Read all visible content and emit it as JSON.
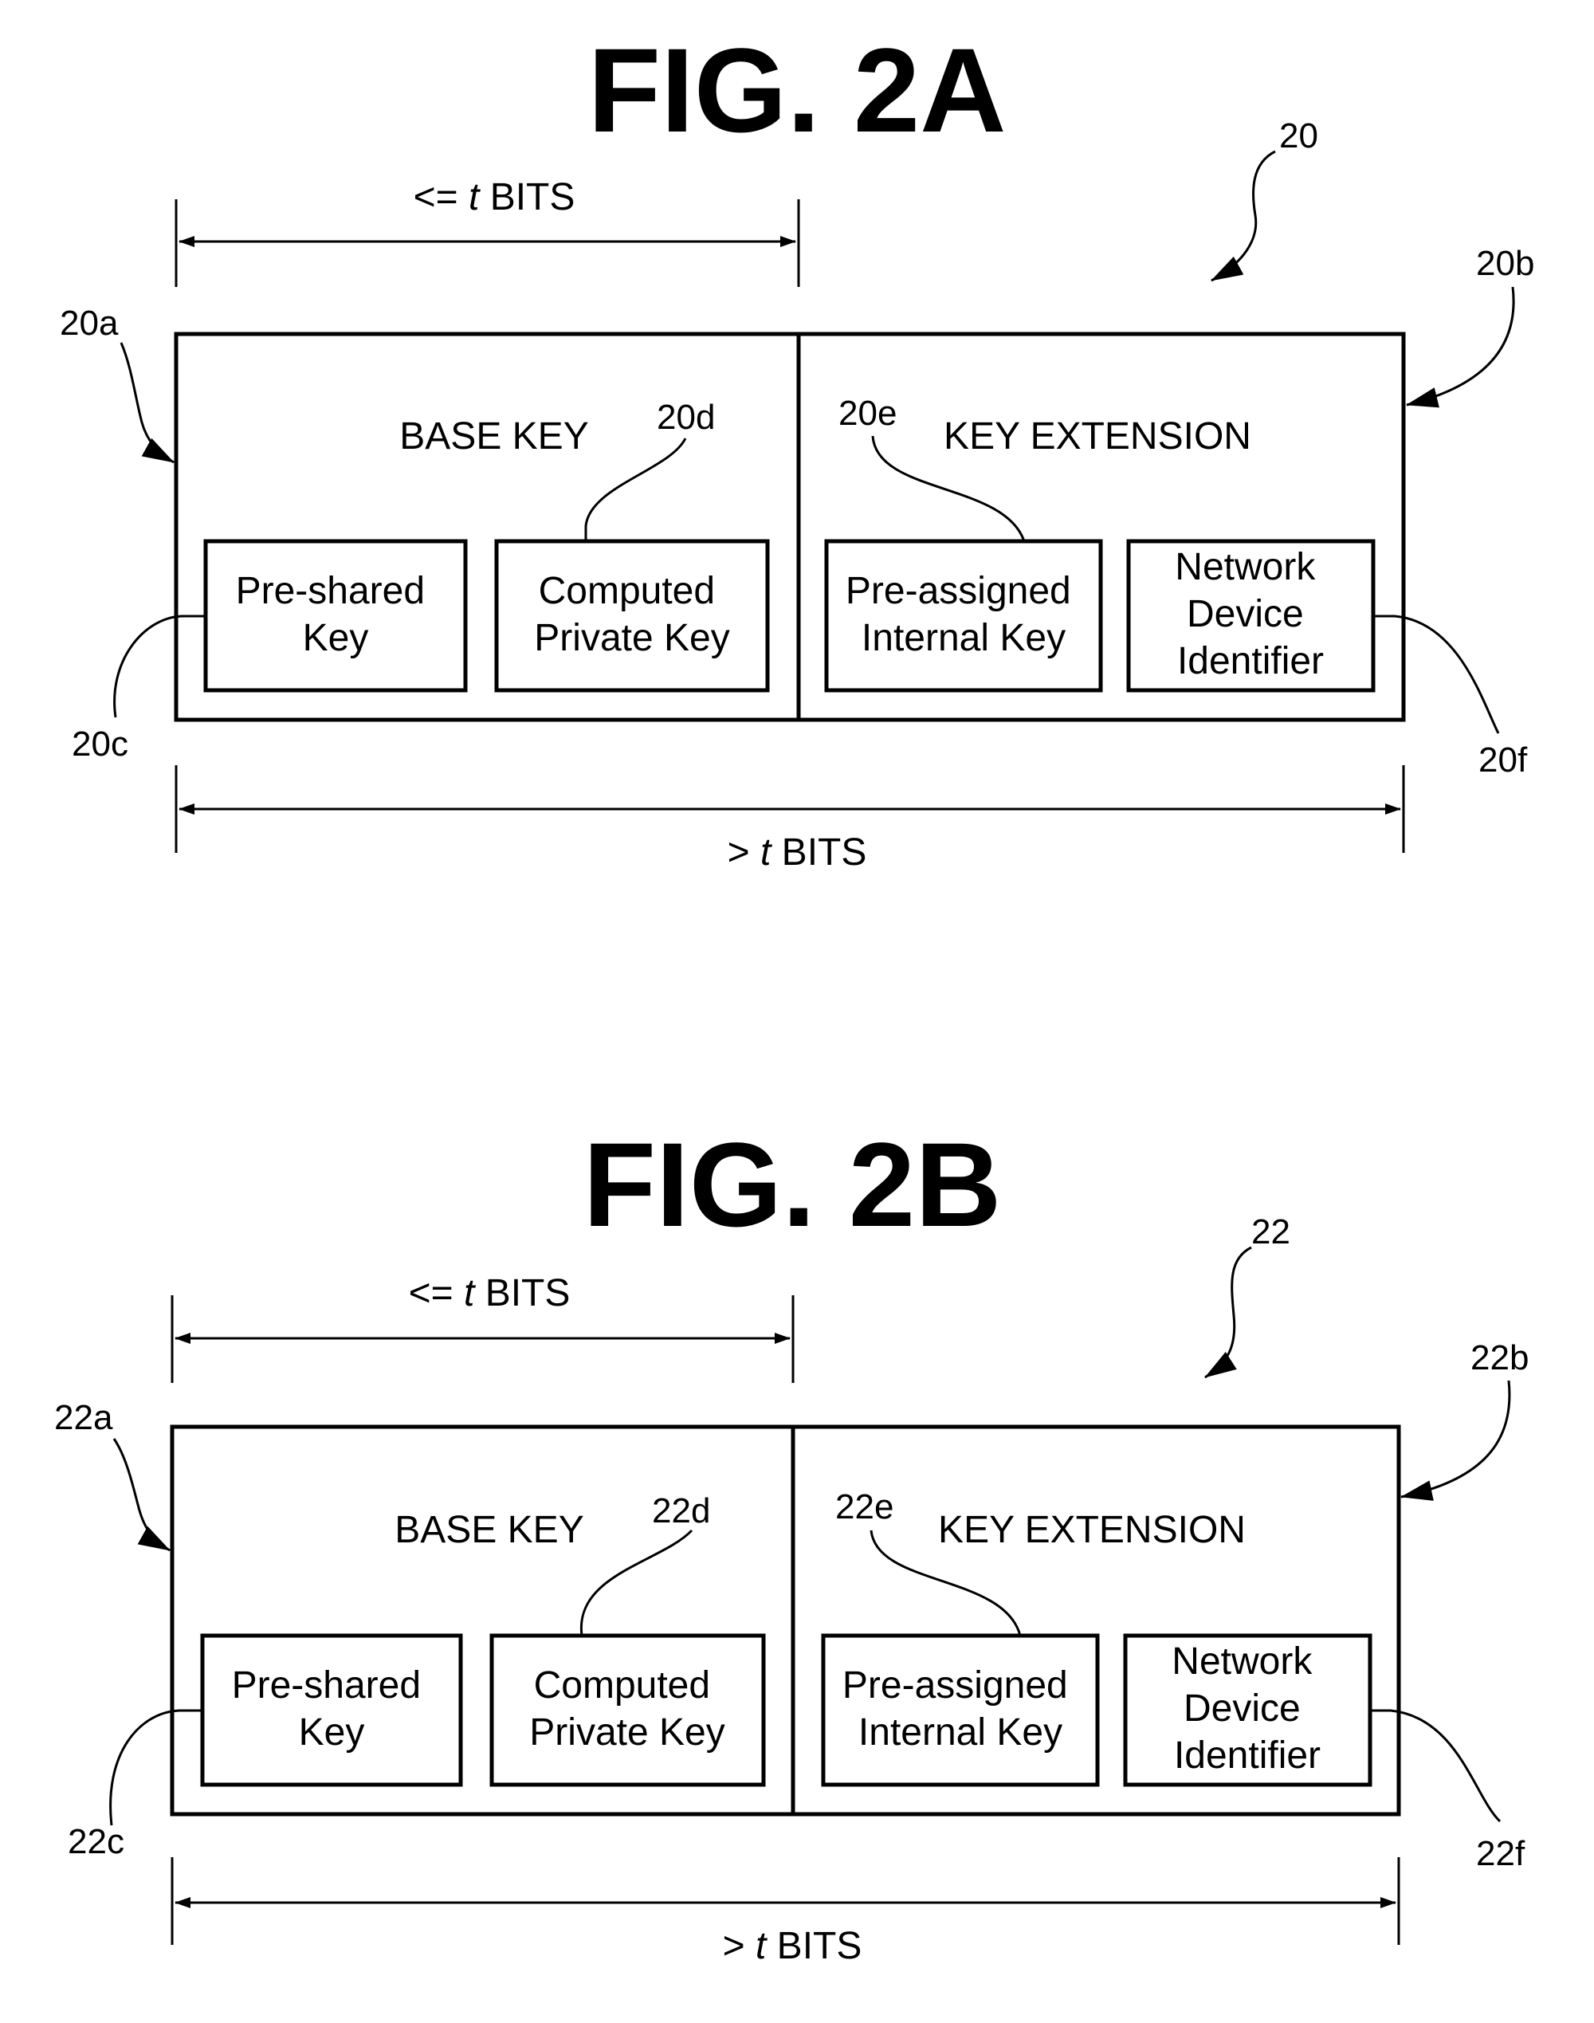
{
  "figures": [
    {
      "title": "FIG. 2A",
      "ref_main": "20",
      "ref_base": "20a",
      "ref_ext": "20b",
      "ref_preshared": "20c",
      "ref_computed": "20d",
      "ref_preassigned": "20e",
      "ref_network": "20f",
      "base_label": "BASE KEY",
      "ext_label": "KEY EXTENSION",
      "top_dim_prefix": "<= ",
      "top_dim_var": "t",
      "top_dim_suffix": " BITS",
      "bottom_dim_prefix": "> ",
      "bottom_dim_var": "t",
      "bottom_dim_suffix": " BITS",
      "boxes": [
        {
          "lines": [
            "Pre-shared",
            "Key"
          ]
        },
        {
          "lines": [
            "Computed",
            "Private Key"
          ]
        },
        {
          "lines": [
            "Pre-assigned",
            "Internal Key"
          ]
        },
        {
          "lines": [
            "Network",
            "Device",
            "Identifier"
          ]
        }
      ]
    },
    {
      "title": "FIG. 2B",
      "ref_main": "22",
      "ref_base": "22a",
      "ref_ext": "22b",
      "ref_preshared": "22c",
      "ref_computed": "22d",
      "ref_preassigned": "22e",
      "ref_network": "22f",
      "base_label": "BASE KEY",
      "ext_label": "KEY EXTENSION",
      "top_dim_prefix": "<= ",
      "top_dim_var": "t",
      "top_dim_suffix": " BITS",
      "bottom_dim_prefix": "> ",
      "bottom_dim_var": "t",
      "bottom_dim_suffix": " BITS",
      "boxes": [
        {
          "lines": [
            "Pre-shared",
            "Key"
          ]
        },
        {
          "lines": [
            "Computed",
            "Private Key"
          ]
        },
        {
          "lines": [
            "Pre-assigned",
            "Internal Key"
          ]
        },
        {
          "lines": [
            "Network",
            "Device",
            "Identifier"
          ]
        }
      ]
    }
  ]
}
